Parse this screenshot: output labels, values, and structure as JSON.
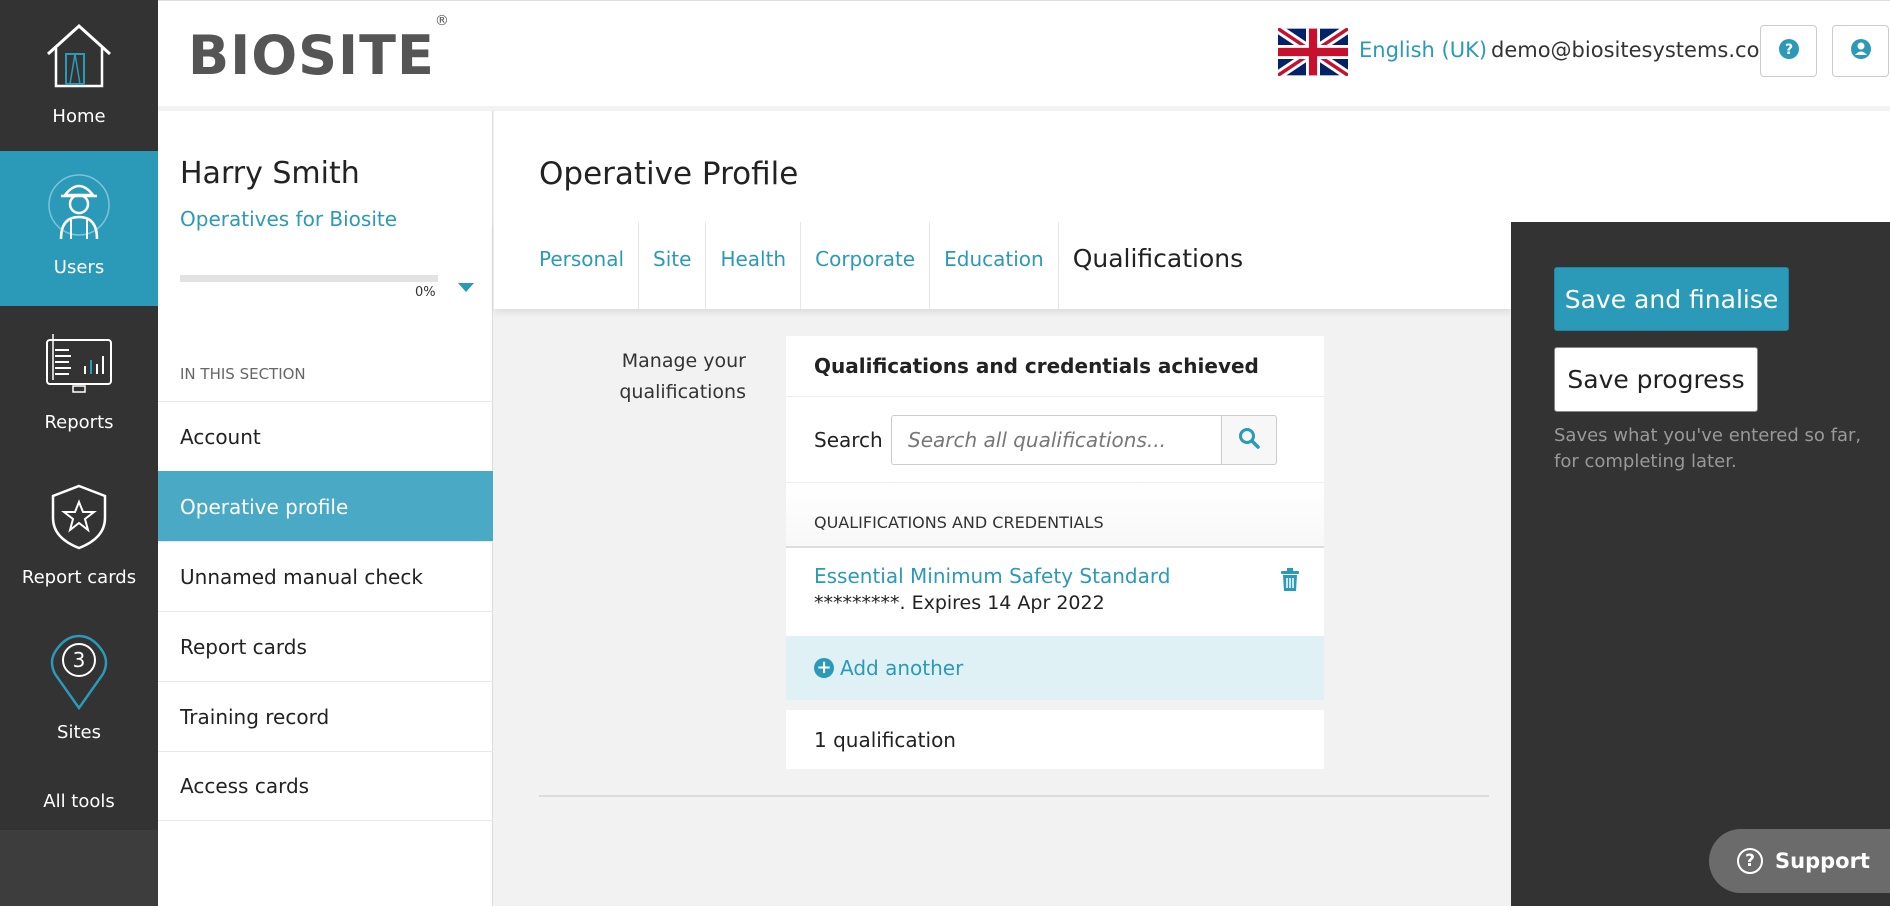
{
  "nav": {
    "items": [
      {
        "label": "Home",
        "icon": "home-icon"
      },
      {
        "label": "Users",
        "icon": "user-hardhat-icon"
      },
      {
        "label": "Reports",
        "icon": "report-chart-icon"
      },
      {
        "label": "Report cards",
        "icon": "shield-star-icon"
      },
      {
        "label": "Sites",
        "icon": "map-pin-icon"
      }
    ],
    "all_tools": "All tools"
  },
  "header": {
    "logo": "BIOSITE",
    "logo_mark": "®",
    "language": "English (UK)",
    "email": "demo@biositesystems.com"
  },
  "profile": {
    "name": "Harry Smith",
    "org": "Operatives for Biosite",
    "progress_percent": 0,
    "progress_text": "0%",
    "section_label": "IN THIS SECTION",
    "menu": [
      {
        "label": "Account"
      },
      {
        "label": "Operative profile"
      },
      {
        "label": "Unnamed manual check"
      },
      {
        "label": "Report cards"
      },
      {
        "label": "Training record"
      },
      {
        "label": "Access cards"
      }
    ]
  },
  "main": {
    "title": "Operative Profile",
    "tabs": [
      "Personal",
      "Site",
      "Health",
      "Corporate",
      "Education",
      "Qualifications"
    ],
    "manage_label": "Manage your qualifications",
    "card": {
      "heading": "Qualifications and credentials achieved",
      "search_label": "Search",
      "search_placeholder": "Search all qualifications...",
      "column_header": "QUALIFICATIONS AND CREDENTIALS",
      "rows": [
        {
          "title": "Essential Minimum Safety Standard",
          "detail": "*********. Expires 14 Apr 2022"
        }
      ],
      "add_label": "Add another",
      "count_text": "1 qualification"
    }
  },
  "actions": {
    "finalise": "Save and finalise",
    "progress": "Save progress",
    "hint": "Saves what you've entered so far, for completing later."
  },
  "support": {
    "label": "Support"
  },
  "colors": {
    "accent": "#2b9ab8",
    "nav_bg": "#333333",
    "active_menu": "#4aa9c4"
  }
}
